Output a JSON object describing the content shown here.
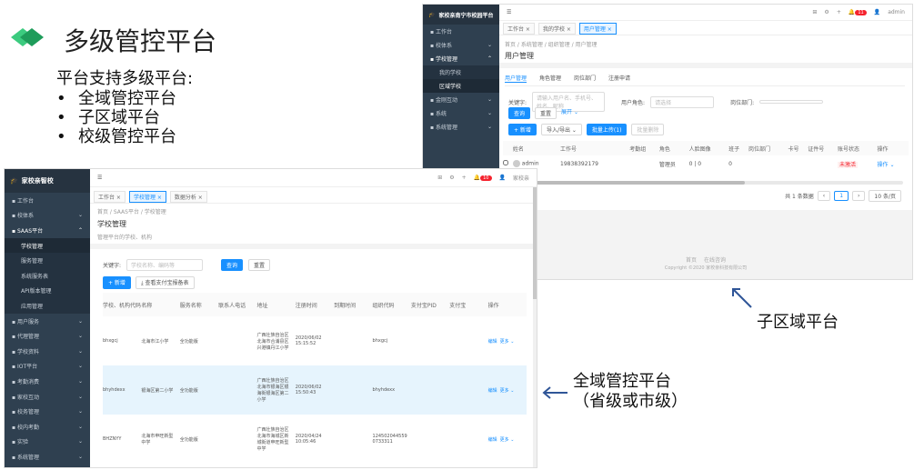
{
  "slide": {
    "title": "多级管控平台",
    "intro": "平台支持多级平台:",
    "bullets": [
      "全域管控平台",
      "子区域平台",
      "校级管控平台"
    ],
    "bullet_glyph": "•",
    "label_sub": "子区域平台",
    "label_global_line1": "全域管控平台",
    "label_global_line2": "（省级或市级）",
    "accent_color": "#2eb872",
    "arrow_color": "#2f5597"
  },
  "screen_sub": {
    "brand": "家校亲南宁市校园平台",
    "sidebar": [
      {
        "label": "工作台",
        "icon": "dashboard-icon"
      },
      {
        "label": "校体系",
        "icon": "school-icon",
        "arrow": "⌄"
      },
      {
        "label": "学校管理",
        "icon": "school-icon",
        "arrow": "⌃",
        "active": true
      },
      {
        "label": "我的学校",
        "sub": true
      },
      {
        "label": "区域学校",
        "sub": true,
        "active": true
      },
      {
        "label": "金刚互动",
        "icon": "interact-icon",
        "arrow": "⌄"
      },
      {
        "label": "系统",
        "icon": "settings-icon",
        "arrow": "⌄"
      },
      {
        "label": "系统管理",
        "icon": "settings-icon",
        "arrow": "⌄"
      }
    ],
    "tabs": [
      "工作台 ×",
      "我的学校 ×",
      "用户管理 ×"
    ],
    "active_tab": 2,
    "breadcrumb": "首页 / 系统管理 / 组织管理 / 用户管理",
    "page_title": "用户管理",
    "subtabs": [
      "用户管理",
      "角色管理",
      "岗位部门",
      "注册申请"
    ],
    "filter_keyword_label": "关键字:",
    "filter_keyword_placeholder": "请输入用户名、手机号、姓名、昵称",
    "filter_role_label": "用户角色:",
    "filter_role_placeholder": "请选择",
    "filter_dept_label": "岗位部门:",
    "btn_search": "查询",
    "btn_reset": "重置",
    "btn_expand": "展开 ⌄",
    "btn_add": "+ 新增",
    "btn_import": "导入/导出 ⌄",
    "btn_batch": "批量上传(1)",
    "btn_more": "批量删除",
    "columns": [
      "姓名",
      "工作号",
      "考勤组",
      "角色",
      "人脸图像",
      "班子",
      "岗位部门",
      "卡号",
      "证件号",
      "账号状态",
      "操作"
    ],
    "row": {
      "name": "admin",
      "phone": "19838392179",
      "role": "管理员",
      "face": "0 | 0",
      "num": "0",
      "status": "未激活",
      "op": "操作 ⌄"
    },
    "pagination_total": "共 1 条数据",
    "pagination_page": "1",
    "pagination_size": "10 条/页",
    "footer_links": "首页　   在线咨询",
    "footer_copyright": "Copyright ©2020 家校亲科技有限公司",
    "admin": "admin",
    "badge": "11"
  },
  "screen_main": {
    "brand": "家校亲智校",
    "sidebar": [
      {
        "label": "工作台",
        "icon": "dashboard-icon"
      },
      {
        "label": "校体系",
        "icon": "school-icon",
        "arrow": "⌄"
      },
      {
        "label": "SAAS平台",
        "icon": "cloud-icon",
        "arrow": "⌃",
        "active": true
      },
      {
        "label": "学校管理",
        "sub": true,
        "active": true
      },
      {
        "label": "服务管理",
        "sub": true
      },
      {
        "label": "系统服务表",
        "sub": true
      },
      {
        "label": "API版本管理",
        "sub": true
      },
      {
        "label": "应用管理",
        "sub": true
      },
      {
        "label": "用户服务",
        "icon": "user-icon",
        "arrow": "⌄"
      },
      {
        "label": "代理管理",
        "icon": "agent-icon",
        "arrow": "⌄"
      },
      {
        "label": "学校资料",
        "icon": "file-icon",
        "arrow": "⌄"
      },
      {
        "label": "IOT平台",
        "icon": "iot-icon",
        "arrow": "⌄"
      },
      {
        "label": "考勤消费",
        "icon": "pay-icon",
        "arrow": "⌄"
      },
      {
        "label": "家校互动",
        "icon": "interact-icon",
        "arrow": "⌄"
      },
      {
        "label": "校务管理",
        "icon": "task-icon",
        "arrow": "⌄"
      },
      {
        "label": "校内考勤",
        "icon": "check-icon",
        "arrow": "⌄"
      },
      {
        "label": "实验",
        "icon": "lab-icon",
        "arrow": "⌄"
      },
      {
        "label": "系统管理",
        "icon": "settings-icon",
        "arrow": "⌄"
      }
    ],
    "tabs": [
      "工作台 ×",
      "学校管理 ×",
      "数据分析 ×"
    ],
    "active_tab": 1,
    "breadcrumb": "首页 / SAAS平台 / 学校管理",
    "page_title": "学校管理",
    "page_desc": "管理平台的学校、机构",
    "filter_keyword_label": "关键字:",
    "filter_keyword_placeholder": "学校名称、编码等",
    "btn_search": "查询",
    "btn_reset": "重置",
    "btn_add": "+ 新增",
    "btn_download": "⤓ 查看支付宝报备表",
    "columns": [
      "学校、机构代码",
      "名称",
      "服务名称",
      "联系人电话",
      "地址",
      "注册时间",
      "到期时间",
      "组织代码",
      "支付宝PID",
      "支付宝",
      "操作"
    ],
    "rows": [
      {
        "code": "bhxgcj",
        "name": "北海市江小学",
        "service": "全功能版",
        "address": "广西壮族自治区北海市合浦县区兴港镇丹江小学",
        "reg": "2020/06/02 15:15:52",
        "org": "bhxgcj",
        "pid": "",
        "edit": "编辑",
        "more": "更多 ⌄"
      },
      {
        "code": "bhyhdexx",
        "name": "银海区第二小学",
        "service": "全功能版",
        "address": "广西壮族自治区北海市银海区银海街银海区第二小学",
        "reg": "2020/06/02 15:50:43",
        "org": "bhyhdexx",
        "pid": "",
        "edit": "编辑",
        "more": "更多 ⌄"
      },
      {
        "code": "BHZNYY",
        "name": "北海市申旺新型中学",
        "service": "全功能版",
        "address": "广西壮族自治区北海市海城区新城街道申旺新型中学",
        "reg": "2020/04/24 10:05:46",
        "org": "124502044559 0733311",
        "pid": "",
        "edit": "编辑",
        "more": "更多 ⌄"
      }
    ],
    "admin": "家校亲",
    "badge": "10"
  }
}
